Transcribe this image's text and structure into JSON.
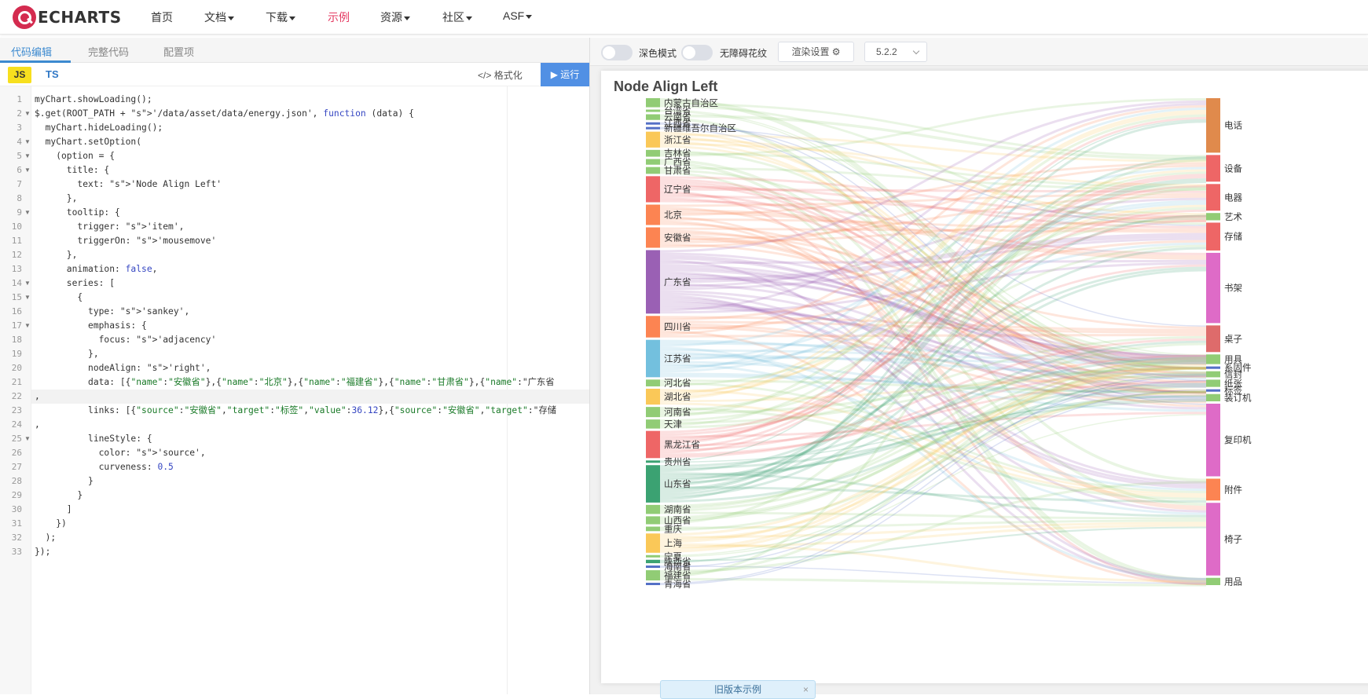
{
  "nav": {
    "logo_text": "ECHARTS",
    "items": [
      {
        "label": "首页",
        "dropdown": false
      },
      {
        "label": "文档",
        "dropdown": true
      },
      {
        "label": "下载",
        "dropdown": true
      },
      {
        "label": "示例",
        "dropdown": false,
        "active": true
      },
      {
        "label": "资源",
        "dropdown": true
      },
      {
        "label": "社区",
        "dropdown": true
      },
      {
        "label": "ASF",
        "dropdown": true
      }
    ]
  },
  "editor": {
    "tabs": [
      "代码编辑",
      "完整代码",
      "配置项"
    ],
    "lang_js": "JS",
    "lang_ts": "TS",
    "format_label": "格式化",
    "run_label": "运行",
    "lines": [
      "myChart.showLoading();",
      "$.get(ROOT_PATH + '/data/asset/data/energy.json', function (data) {",
      "  myChart.hideLoading();",
      "  myChart.setOption(",
      "    (option = {",
      "      title: {",
      "        text: 'Node Align Left'",
      "      },",
      "      tooltip: {",
      "        trigger: 'item',",
      "        triggerOn: 'mousemove'",
      "      },",
      "      animation: false,",
      "      series: [",
      "        {",
      "          type: 'sankey',",
      "          emphasis: {",
      "            focus: 'adjacency'",
      "          },",
      "          nodeAlign: 'right',",
      "          data: [{\"name\":\"安徽省\"},{\"name\":\"北京\"},{\"name\":\"福建省\"},{\"name\":\"甘肃省\"},{\"name\":\"广东省",
      ",",
      "          links: [{\"source\":\"安徽省\",\"target\":\"标签\",\"value\":36.12},{\"source\":\"安徽省\",\"target\":\"存储",
      ",",
      "          lineStyle: {",
      "            color: 'source',",
      "            curveness: 0.5",
      "          }",
      "        }",
      "      ]",
      "    })",
      "  );",
      "});"
    ]
  },
  "preview": {
    "dark_mode_label": "深色模式",
    "a11y_label": "无障碍花纹",
    "render_settings_label": "渲染设置",
    "version": "5.2.2",
    "old_version_banner": "旧版本示例"
  },
  "chart_data": {
    "type": "sankey",
    "title": "Node Align Left",
    "left_nodes": [
      {
        "name": "内蒙古自治区",
        "value": 8,
        "color": "#91cc75"
      },
      {
        "name": "台湾省",
        "value": 2,
        "color": "#91cc75"
      },
      {
        "name": "云南省",
        "value": 5,
        "color": "#91cc75"
      },
      {
        "name": "江西省",
        "value": 1.5,
        "color": "#5470c6"
      },
      {
        "name": "新疆维吾尔自治区",
        "value": 2,
        "color": "#5470c6"
      },
      {
        "name": "浙江省",
        "value": 14,
        "color": "#fac858"
      },
      {
        "name": "吉林省",
        "value": 6,
        "color": "#91cc75"
      },
      {
        "name": "广西省",
        "value": 5,
        "color": "#91cc75"
      },
      {
        "name": "甘肃省",
        "value": 6,
        "color": "#91cc75"
      },
      {
        "name": "辽宁省",
        "value": 23,
        "color": "#ee6666"
      },
      {
        "name": "北京",
        "value": 18,
        "color": "#fc8452"
      },
      {
        "name": "安徽省",
        "value": 18,
        "color": "#fc8452"
      },
      {
        "name": "广东省",
        "value": 56,
        "color": "#9a60b4"
      },
      {
        "name": "四川省",
        "value": 19,
        "color": "#fc8452"
      },
      {
        "name": "江苏省",
        "value": 33,
        "color": "#73c0de"
      },
      {
        "name": "河北省",
        "value": 6,
        "color": "#91cc75"
      },
      {
        "name": "湖北省",
        "value": 14,
        "color": "#fac858"
      },
      {
        "name": "河南省",
        "value": 9,
        "color": "#91cc75"
      },
      {
        "name": "天津",
        "value": 8,
        "color": "#91cc75"
      },
      {
        "name": "黑龙江省",
        "value": 24,
        "color": "#ee6666"
      },
      {
        "name": "贵州省",
        "value": 2,
        "color": "#3ba272"
      },
      {
        "name": "山东省",
        "value": 33,
        "color": "#3ba272"
      },
      {
        "name": "湖南省",
        "value": 8,
        "color": "#91cc75"
      },
      {
        "name": "山西省",
        "value": 7,
        "color": "#91cc75"
      },
      {
        "name": "重庆",
        "value": 4,
        "color": "#91cc75"
      },
      {
        "name": "上海",
        "value": 17,
        "color": "#fac858"
      },
      {
        "name": "宁夏",
        "value": 1,
        "color": "#91cc75"
      },
      {
        "name": "陕西省",
        "value": 3,
        "color": "#3ba272"
      },
      {
        "name": "海南省",
        "value": 2,
        "color": "#5470c6"
      },
      {
        "name": "福建省",
        "value": 9,
        "color": "#91cc75"
      },
      {
        "name": "青海省",
        "value": 2,
        "color": "#5470c6"
      }
    ],
    "right_nodes": [
      {
        "name": "电话",
        "value": 45,
        "color": "#e08a4c"
      },
      {
        "name": "设备",
        "value": 22,
        "color": "#ee6666"
      },
      {
        "name": "电器",
        "value": 22,
        "color": "#ee6666"
      },
      {
        "name": "艺术",
        "value": 6,
        "color": "#91cc75"
      },
      {
        "name": "存储",
        "value": 23,
        "color": "#ee6666"
      },
      {
        "name": "书架",
        "value": 58,
        "color": "#de6bc7"
      },
      {
        "name": "桌子",
        "value": 22,
        "color": "#de6b6b"
      },
      {
        "name": "用具",
        "value": 8,
        "color": "#91cc75"
      },
      {
        "name": "系固件",
        "value": 2,
        "color": "#5470c6"
      },
      {
        "name": "信封",
        "value": 5,
        "color": "#91cc75"
      },
      {
        "name": "纸张",
        "value": 6,
        "color": "#91cc75"
      },
      {
        "name": "标签",
        "value": 2,
        "color": "#5470c6"
      },
      {
        "name": "装订机",
        "value": 6,
        "color": "#91cc75"
      },
      {
        "name": "复印机",
        "value": 60,
        "color": "#de6bc7"
      },
      {
        "name": "附件",
        "value": 18,
        "color": "#fc8452"
      },
      {
        "name": "椅子",
        "value": 60,
        "color": "#de6bc7"
      },
      {
        "name": "用品",
        "value": 6,
        "color": "#91cc75"
      }
    ]
  }
}
